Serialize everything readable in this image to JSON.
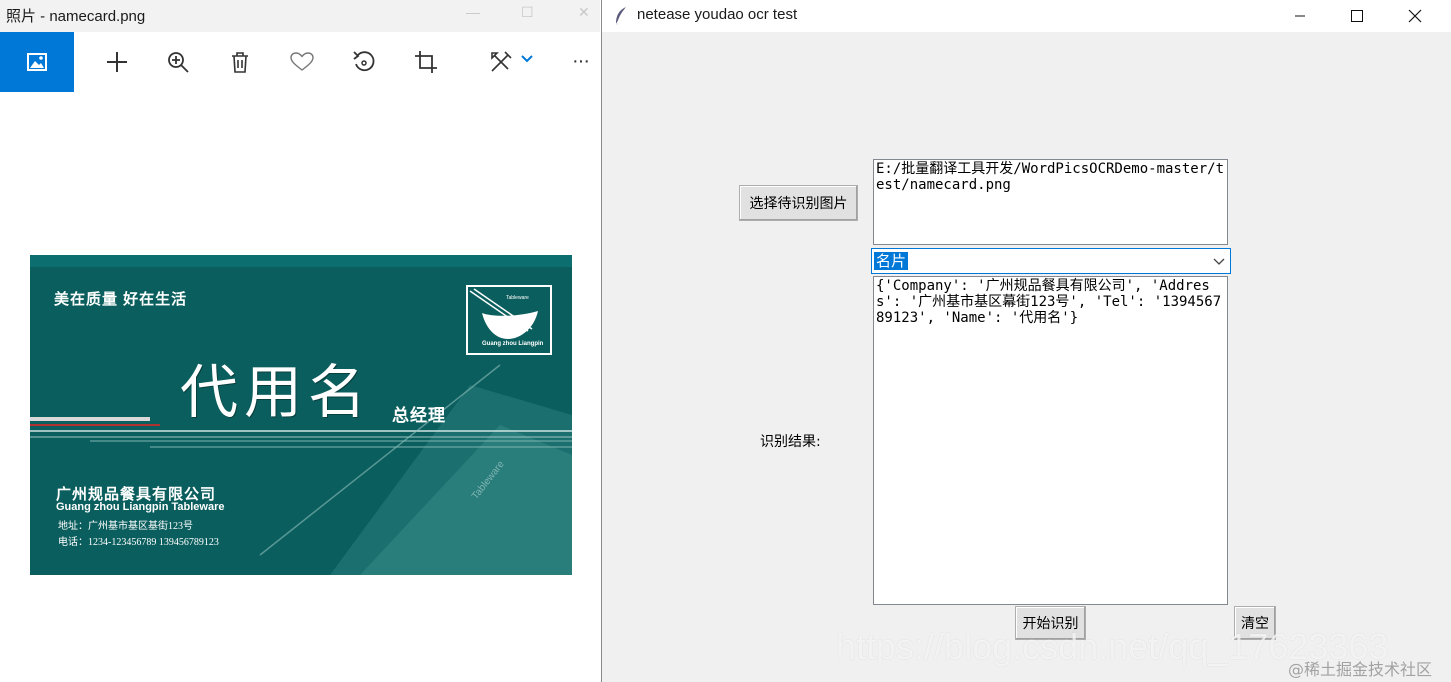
{
  "photos": {
    "title": "照片 - namecard.png",
    "toolbar": {
      "icons": [
        "photo-icon",
        "plus-icon",
        "zoom-in-icon",
        "trash-icon",
        "heart-icon",
        "rotate-icon",
        "crop-icon",
        "edit-icon",
        "chevron-down-icon",
        "more-icon"
      ],
      "more_label": "···"
    },
    "card": {
      "slogan": "美在质量  好在生活",
      "name": "代用名",
      "position": "总经理",
      "company": "广州规品餐具有限公司",
      "company_en": "Guang zhou Liangpin Tableware",
      "address": "地址：广州基市基区基街123号",
      "phone": "电话：1234-123456789  139456789123",
      "logo_top": "Tableware",
      "logo_bottom": "Guang zhou Liangpin",
      "watermark_text": "Tableware",
      "colors": {
        "background": "#0b5e5e",
        "text": "#ffffff"
      }
    }
  },
  "tk": {
    "title": "netease youdao ocr test",
    "icon": "feather-icon",
    "select_button": "选择待识别图片",
    "path_text": "E:/批量翻译工具开发/WordPicsOCRDemo-master/test/namecard.png",
    "type_select": {
      "selected": "名片"
    },
    "result_label": "识别结果:",
    "result_text": "{'Company': '广州规品餐具有限公司', 'Address': '广州基市基区幕街123号', 'Tel': '139456789123', 'Name': '代用名'}",
    "start_button": "开始识别",
    "clear_button": "清空",
    "window_controls": [
      "minimize-icon",
      "maximize-icon",
      "close-icon"
    ]
  },
  "overlay": {
    "watermark": "https://blog.csdn.net/qq_17623363",
    "watermark_juejin": "@稀土掘金技术社区"
  },
  "colors": {
    "accent": "#0078d7",
    "tk_background": "#f0f0f0"
  }
}
